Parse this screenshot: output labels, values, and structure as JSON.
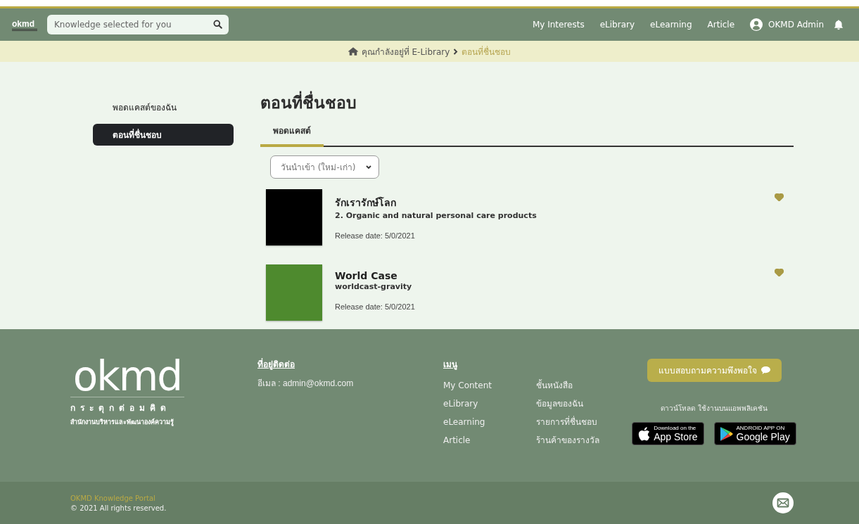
{
  "header": {
    "logo": "okmd",
    "search": {
      "placeholder": "Knowledge selected for you"
    },
    "nav": [
      "My Interests",
      "eLibrary",
      "eLearning",
      "Article"
    ],
    "user": "OKMD Admin"
  },
  "breadcrumb": {
    "current_location": "คุณกำลังอยู่ที่ E-Library",
    "page": "ตอนที่ชื่นชอบ"
  },
  "sidebar": {
    "items": [
      {
        "label": "พอดแคสต์ของฉัน",
        "selected": false
      },
      {
        "label": "ตอนที่ชื่นชอบ",
        "selected": true
      }
    ]
  },
  "content": {
    "title": "ตอนที่ชื่นชอบ",
    "tabs": [
      {
        "label": "พอดแคสต์",
        "selected": true
      }
    ],
    "sort": {
      "value": "วันนำเข้า (ใหม่-เก่า)"
    },
    "episodes": [
      {
        "podcast": "รักเรารักษ์โลก",
        "episode": "2. Organic and natural personal care products",
        "release": "Release date: 5/0/2021",
        "liked": true,
        "color": "#000000"
      },
      {
        "podcast": "World Case",
        "episode": "worldcast-gravity",
        "release": "Release date: 5/0/2021",
        "liked": true,
        "color": "#4e8a2e"
      }
    ]
  },
  "footer": {
    "logo": {
      "wordmark": "okmd",
      "tagline": "กระตุกต่อมคิด",
      "agency": "สำนักงานบริหารและพัฒนาองค์ความรู้"
    },
    "contact": {
      "heading": "ที่อยู่ติดต่อ",
      "email": "อีเมล : admin@okmd.com"
    },
    "menu": {
      "heading": "เมนู",
      "links": [
        "My Content",
        "eLibrary",
        "eLearning",
        "Article",
        "ชั้นหนังสือ",
        "ข้อมูลของฉัน",
        "รายการที่ชื่นชอบ",
        "ร้านค้าของรางวัล"
      ]
    },
    "survey_button": "แบบสอบถามความพึงพอใจ",
    "download_text": "ดาวน์โหลด ใช้งานบนแอพพลิเคชัน",
    "stores": [
      {
        "kind": "apple",
        "small": "Download on the",
        "big": "App Store"
      },
      {
        "kind": "google",
        "small": "ANDROID APP ON",
        "big": "Google Play"
      }
    ]
  },
  "bottom_bar": {
    "portal": "OKMD Knowledge Portal",
    "copyright": "© 2021 All rights reserved."
  }
}
